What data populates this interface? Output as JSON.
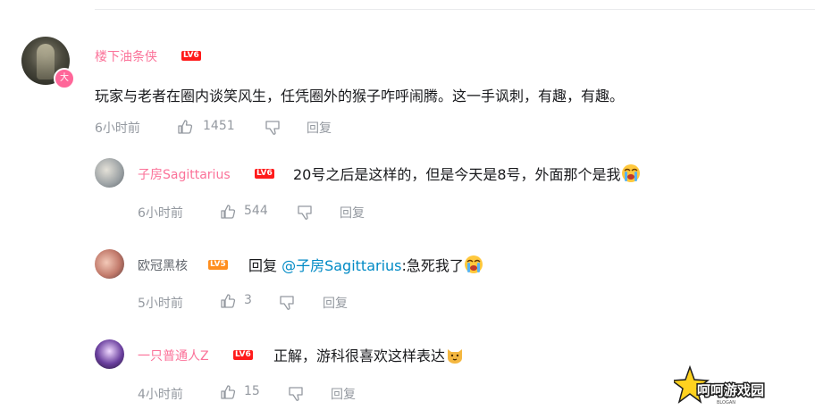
{
  "main_comment": {
    "username": "楼下油条侠",
    "level_badge": "LV6",
    "avatar_badge": "大",
    "text": "玩家与老者在圈内谈笑风生，任凭圈外的猴子咋呼闹腾。这一手讽刺，有趣，有趣。",
    "time": "6小时前",
    "likes": "1451",
    "reply_label": "回复"
  },
  "replies": [
    {
      "username": "子房Sagittarius",
      "level_badge": "LV6",
      "text": "20号之后是这样的，但是今天是8号，外面那个是我",
      "emoji": "crying-emoji",
      "time": "6小时前",
      "likes": "544",
      "reply_label": "回复"
    },
    {
      "username": "欧冠黑核",
      "level_badge": "LV5",
      "reply_prefix": "回复 ",
      "mention": "@子房Sagittarius",
      "text": ":急死我了",
      "emoji": "crying-emoji",
      "time": "5小时前",
      "likes": "3",
      "reply_label": "回复"
    },
    {
      "username": "一只普通人Z",
      "level_badge": "LV6",
      "text": "正解，游科很喜欢这样表达",
      "emoji": "cat-emoji",
      "time": "4小时前",
      "likes": "15",
      "reply_label": "回复"
    }
  ],
  "watermark": {
    "text": "呵呵游戏园",
    "sub": "BLOGAN"
  },
  "colors": {
    "vip_name": "#fb7299",
    "normal_name": "#61666d",
    "mention": "#008ac5",
    "meta": "#9499a0",
    "lv6": "#ff1b1b",
    "lv5": "#ff8f1f"
  }
}
